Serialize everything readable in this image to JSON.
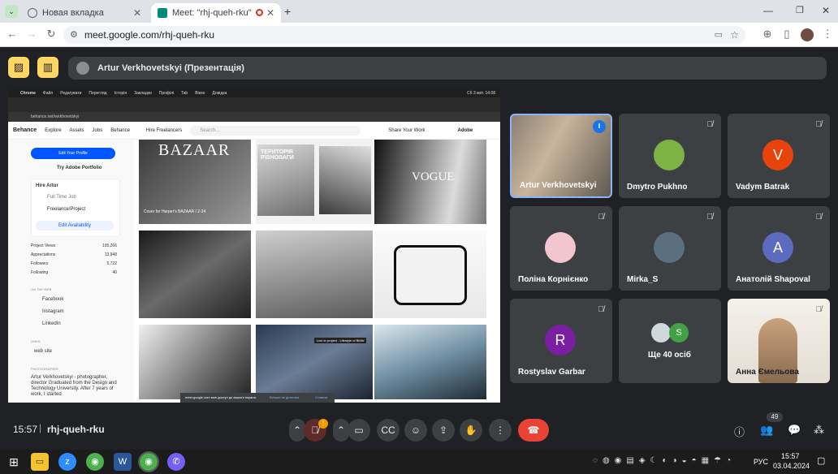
{
  "browser": {
    "tabs": [
      {
        "label": "Новая вкладка"
      },
      {
        "label": "Meet: \"rhj-queh-rku\""
      }
    ],
    "url": "meet.google.com/rhj-queh-rku"
  },
  "meet": {
    "presenter_label": "Artur Verkhovetskyi (Презентація)",
    "meeting_time": "15:57",
    "meeting_code": "rhj-queh-rku",
    "participants_count": "49",
    "mic_badge": "!",
    "tiles": [
      {
        "name": "Artur Verkhovetskyi",
        "type": "video",
        "active": true
      },
      {
        "name": "Dmytro Pukhno",
        "type": "photo",
        "color": "#7cb342"
      },
      {
        "name": "Vadym Batrak",
        "type": "letter",
        "letter": "V",
        "color": "#e8430a"
      },
      {
        "name": "Поліна Корнієнко",
        "type": "photo",
        "color": "#f3c6cf"
      },
      {
        "name": "Mirka_S",
        "type": "photo",
        "color": "#5a6f80"
      },
      {
        "name": "Анатолій Shapoval",
        "type": "letter",
        "letter": "A",
        "color": "#5c6bc0"
      },
      {
        "name": "Rostyslav Garbar",
        "type": "letter",
        "letter": "R",
        "color": "#7b1fa2"
      },
      {
        "name": "Ще 40 осіб",
        "type": "more",
        "letter": "S",
        "color": "#43a047"
      },
      {
        "name": "Анна Ємельова",
        "type": "video"
      }
    ]
  },
  "shared": {
    "chrome_menu": [
      "Chrome",
      "Файл",
      "Редагувати",
      "Перегляд",
      "Історія",
      "Закладки",
      "Профілі",
      "Tab",
      "Вікно",
      "Довідка"
    ],
    "status_time": "Сб 3 квіт. 14:08",
    "url": "behance.net/verkhovetskyi",
    "behance_nav": [
      "Behance",
      "Explore",
      "Assets",
      "Jobs",
      "Behance",
      "Hire Freelancers"
    ],
    "search_placeholder": "Search...",
    "share_work": "Share Your Work",
    "edit_profile": "Edit Your Profile",
    "try_portfolio": "Try Adobe Portfolio",
    "hire_title": "Hire Artur",
    "full_time": "Full Time Job",
    "freelance": "Freelance/Project",
    "edit_availability": "Edit Availability",
    "stats": [
      {
        "label": "Project Views",
        "value": "195,266"
      },
      {
        "label": "Appreciations",
        "value": "13,948"
      },
      {
        "label": "Followers",
        "value": "5,722"
      },
      {
        "label": "Following",
        "value": "40"
      }
    ],
    "on_the_web": "ON THE WEB",
    "links": [
      "Facebook",
      "Instagram",
      "LinkedIn"
    ],
    "links_title": "LINKS",
    "web_site": "web site",
    "about_title": "PHOTOGRAPHER",
    "about_text": "Artur Verkhovetskyi - photographer, director Graduated from the Design and Technology University. After 7 years of work, I started",
    "bazaar": "BAZAAR",
    "cover_caption": "Cover for Harper's BAZAAR / 2-24",
    "territory": "ТЕРИТОРІЯ РІВНОВАГИ",
    "vogue": "VOGUE",
    "bmw_caption": "Link to project - Lifestyle of BMW",
    "share_notice": "meet.google.com мае доступ до вашого екрана.",
    "stop_share": "Більше не ділитися",
    "hide": "Сховати",
    "adobe": "Adobe"
  },
  "taskbar": {
    "lang": "РУС",
    "time": "15:57",
    "date": "03.04.2024"
  }
}
